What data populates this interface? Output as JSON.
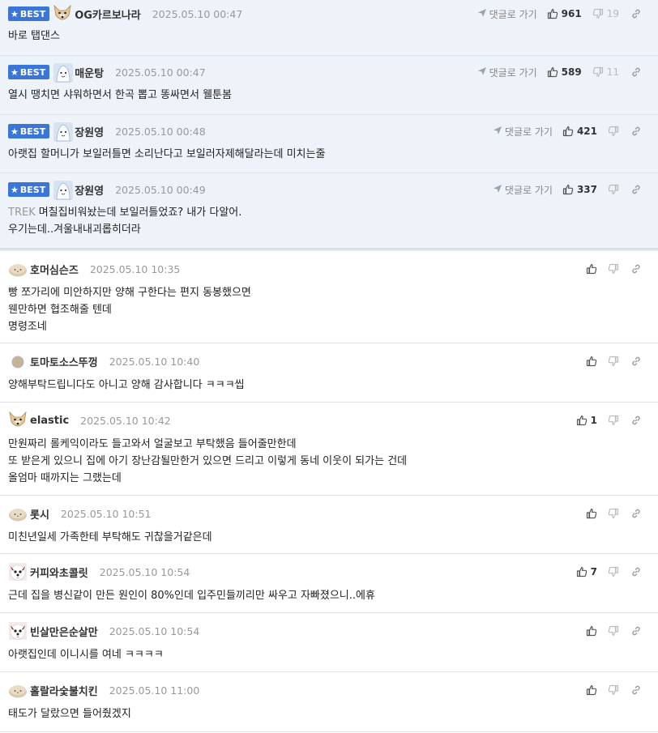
{
  "best_label": "BEST",
  "goto_label": "댓글로 가기",
  "best_comments": [
    {
      "nick": "OG카르보나라",
      "avatar": "dog",
      "date": "2025.05.10 00:47",
      "likes": "961",
      "dislikes": "19",
      "lines": [
        "바로 탭댄스"
      ],
      "reply_to": ""
    },
    {
      "nick": "매운탕",
      "avatar": "blue",
      "date": "2025.05.10 00:47",
      "likes": "589",
      "dislikes": "11",
      "lines": [
        "열시 땡치면 샤워하면서 한곡 뽑고 똥싸면서 웰툰봄"
      ],
      "reply_to": ""
    },
    {
      "nick": "장원영",
      "avatar": "blue",
      "date": "2025.05.10 00:48",
      "likes": "421",
      "dislikes": "",
      "lines": [
        "아랫집 할머니가 보일러틀면 소리난다고 보일러자제해달라는데 미치는줄"
      ],
      "reply_to": ""
    },
    {
      "nick": "장원영",
      "avatar": "blue",
      "date": "2025.05.10 00:49",
      "likes": "337",
      "dislikes": "",
      "lines": [
        "며칠집비워놨는데 보일러틀었죠? 내가 다알어.",
        "우기는데..겨울내내괴롭히더라"
      ],
      "reply_to": "TREK"
    }
  ],
  "comments": [
    {
      "nick": "호머심슨즈",
      "avatar": "potato",
      "date": "2025.05.10 10:35",
      "likes": "",
      "lines": [
        "빵 쪼가리에 미안하지만 양해 구한다는 편지 동봉했으면",
        "웬만하면 협조해줄 텐데",
        "명령조네"
      ]
    },
    {
      "nick": "토마토소스뚜껑",
      "avatar": "dot",
      "date": "2025.05.10 10:40",
      "likes": "",
      "lines": [
        "양해부탁드립니다도 아니고 양해 감사합니다 ㅋㅋㅋ씹"
      ]
    },
    {
      "nick": "elastic",
      "avatar": "dog",
      "date": "2025.05.10 10:42",
      "likes": "1",
      "lines": [
        "만원짜리 롤케익이라도 들고와서 얼굴보고 부탁했음 들어줄만한데",
        "또 받은게 있으니 집에 아기 장난감될만한거 있으면 드리고 이렇게 동네 이웃이 되가는 건데",
        "올엄마 때까지는 그랬는데"
      ]
    },
    {
      "nick": "롯시",
      "avatar": "potato",
      "date": "2025.05.10 10:51",
      "likes": "",
      "lines": [
        "미친년일세 가족한테 부탁해도 귀찮을거같은데"
      ]
    },
    {
      "nick": "커피와초콜릿",
      "avatar": "dog2",
      "date": "2025.05.10 10:54",
      "likes": "7",
      "lines": [
        "근데 집을 병신같이 만든 원인이 80%인데 입주민들끼리만 싸우고 자빠졌으니..에휴"
      ]
    },
    {
      "nick": "빈살만은순살만",
      "avatar": "dog2",
      "date": "2025.05.10 10:54",
      "likes": "",
      "lines": [
        "아랫집인데 이니시를 여네 ㅋㅋㅋㅋ"
      ]
    },
    {
      "nick": "홀랄라숯불치킨",
      "avatar": "potato",
      "date": "2025.05.10 11:00",
      "likes": "",
      "lines": [
        "태도가 달랐으면 들어줬겠지"
      ]
    }
  ],
  "colors": {
    "best_badge": "#3b76d6",
    "best_bg": "#eef2f9"
  }
}
